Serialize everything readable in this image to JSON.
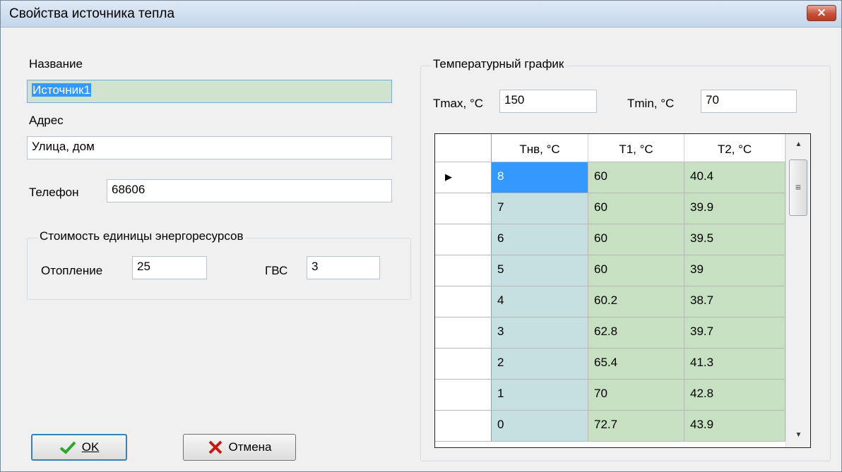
{
  "window": {
    "title": "Свойства источника тепла",
    "close_label": "×"
  },
  "left": {
    "name_label": "Название",
    "name_value": "Источник1",
    "address_label": "Адрес",
    "address_value": "Улица, дом",
    "phone_label": "Телефон",
    "phone_value": "68606",
    "cost_group_title": "Стоимость единицы энергоресурсов",
    "heating_label": "Отопление",
    "heating_value": "25",
    "gvs_label": "ГВС",
    "gvs_value": "3"
  },
  "buttons": {
    "ok_label": "OK",
    "cancel_label": "Отмена"
  },
  "schedule": {
    "group_title": "Температурный график",
    "tmax_label": "Tmax, °C",
    "tmax_value": "150",
    "tmin_label": "Tmin, °C",
    "tmin_value": "70",
    "columns": [
      "Тнв, °C",
      "T1, °C",
      "T2, °C"
    ],
    "rows": [
      [
        "8",
        "60",
        "40.4"
      ],
      [
        "7",
        "60",
        "39.9"
      ],
      [
        "6",
        "60",
        "39.5"
      ],
      [
        "5",
        "60",
        "39"
      ],
      [
        "4",
        "60.2",
        "38.7"
      ],
      [
        "3",
        "62.8",
        "39.7"
      ],
      [
        "2",
        "65.4",
        "41.3"
      ],
      [
        "1",
        "70",
        "42.8"
      ],
      [
        "0",
        "72.7",
        "43.9"
      ]
    ],
    "current_row_marker": "▶"
  },
  "colors": {
    "cell_blue": "#c6dfe0",
    "cell_green": "#c8e0c2",
    "selection": "#3399ff"
  }
}
